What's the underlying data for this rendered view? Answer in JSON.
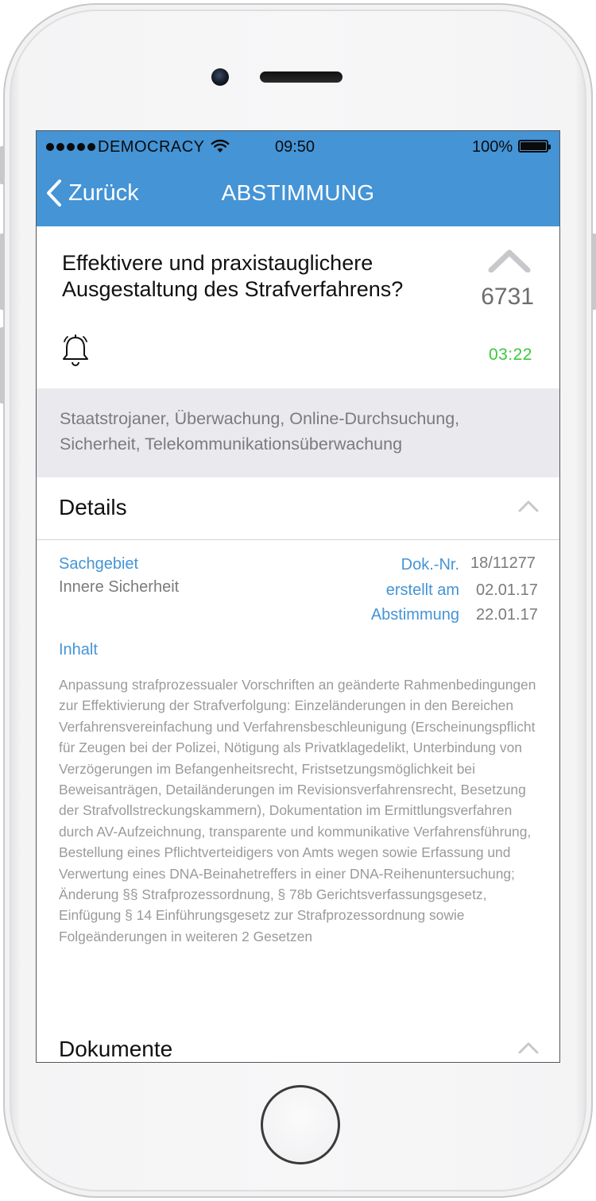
{
  "status_bar": {
    "carrier": "DEMOCRACY",
    "time": "09:50",
    "battery": "100%",
    "battery_level": 1.0
  },
  "nav": {
    "back_label": "Zurück",
    "title": "ABSTIMMUNG"
  },
  "procedure": {
    "title": "Effektivere und praxistauglichere Ausgestaltung des Strafverfahrens?",
    "votes": "6731",
    "timer": "03:22",
    "tags": "Staatstrojaner, Überwachung, Online-Durchsuchung, Sicherheit, Telekommunikationsüberwachung"
  },
  "details": {
    "heading": "Details",
    "sachgebiet_label": "Sachgebiet",
    "sachgebiet_value": "Innere Sicherheit",
    "doknr_label": "Dok.-Nr.",
    "doknr_value": "18/11277",
    "erstellt_label": "erstellt am",
    "erstellt_value": "02.01.17",
    "abstimmung_label": "Abstimmung",
    "abstimmung_value": "22.01.17",
    "inhalt_label": "Inhalt",
    "inhalt_text": "Anpassung strafprozessualer Vorschriften an geänderte Rahmenbedingungen zur Effektivierung der Strafverfolgung: Einzeländerungen in den Bereichen Verfahrensvereinfachung und Verfahrensbeschleunigung (Erscheinungspflicht für Zeugen bei der Polizei, Nötigung als Privatklagedelikt, Unterbindung von Verzögerungen im Befangenheitsrecht, Fristsetzungsmöglichkeit bei Beweisanträgen, Detailänderungen im Revisionsverfahrensrecht, Besetzung der Strafvollstreckungskammern), Dokumentation im Ermittlungsverfahren durch AV-Aufzeichnung, transparente und kommunikative Verfahrensführung, Bestellung eines Pflichtverteidigers von Amts wegen sowie Erfassung und Verwertung eines DNA-Beinahetreffers in einer DNA-Reihenuntersuchung; Änderung §§ Strafprozessordnung, § 78b Gerichtsverfassungsgesetz, Einfügung § 14 Einführungsgesetz zur Strafprozessordnung sowie Folgeänderungen in weiteren 2 Gesetzen"
  },
  "documents": {
    "heading": "Dokumente"
  },
  "colors": {
    "nav_blue": "#4494d6",
    "timer_green": "#3cc83c",
    "tag_background": "#e9e9ee"
  },
  "icons": {
    "back": "chevron-left-icon",
    "upvote": "chevron-up-icon",
    "notify": "bell-icon",
    "wifi": "wifi-icon",
    "battery": "battery-icon",
    "collapse": "chevron-up-icon"
  }
}
